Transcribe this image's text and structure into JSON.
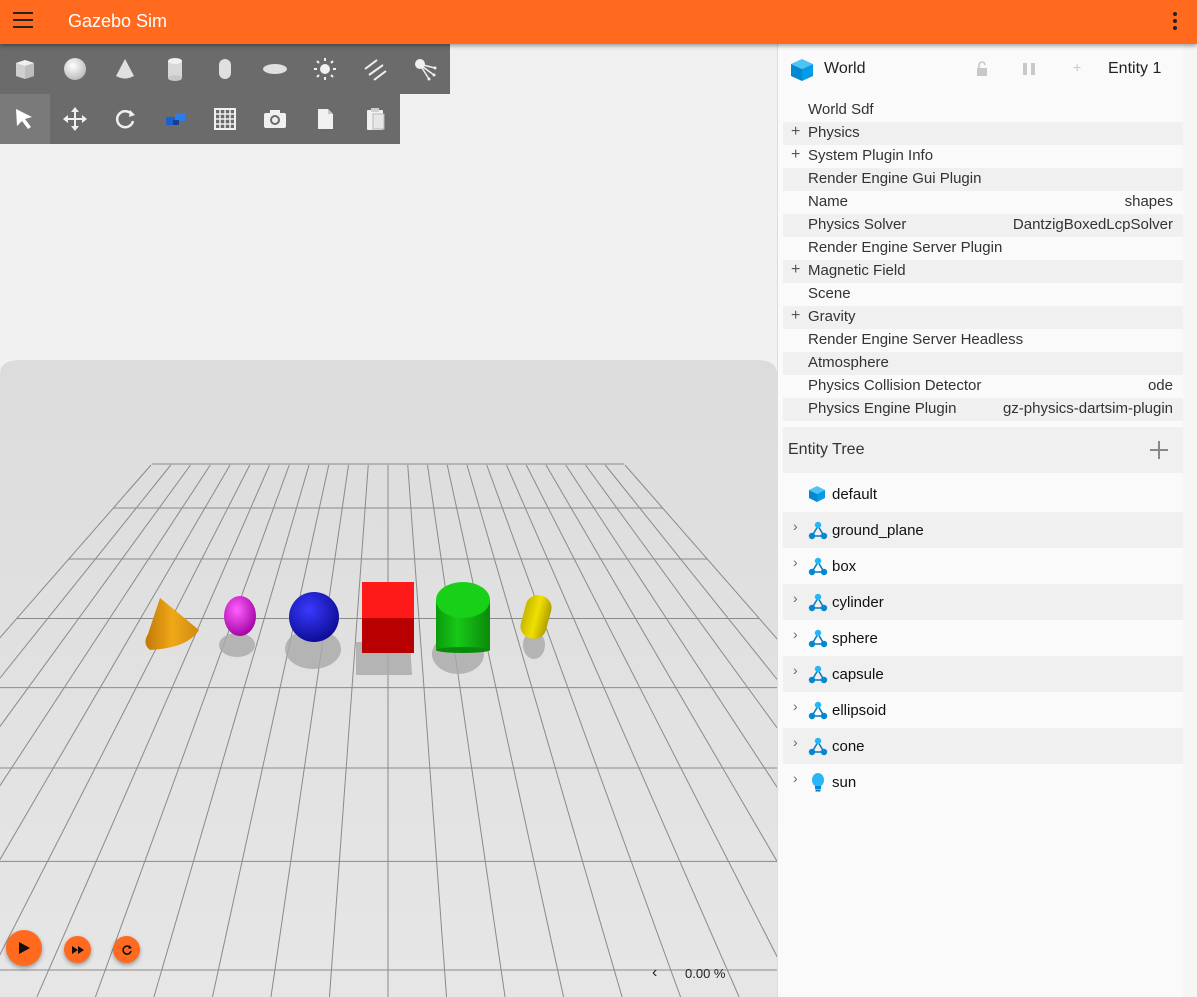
{
  "app": {
    "title": "Gazebo Sim"
  },
  "toolbar": {
    "shapes": [
      {
        "name": "box",
        "icon": "box-icon"
      },
      {
        "name": "sphere",
        "icon": "sphere-icon"
      },
      {
        "name": "cone",
        "icon": "cone-icon"
      },
      {
        "name": "cylinder",
        "icon": "cylinder-icon"
      },
      {
        "name": "capsule",
        "icon": "capsule-icon"
      },
      {
        "name": "ellipsoid",
        "icon": "ellipsoid-icon"
      },
      {
        "name": "point-light",
        "icon": "sun-icon"
      },
      {
        "name": "directional-light",
        "icon": "directional-light-icon"
      },
      {
        "name": "spot-light",
        "icon": "spot-light-icon"
      }
    ],
    "tools": [
      {
        "name": "select",
        "icon": "select-arrow-icon"
      },
      {
        "name": "translate",
        "icon": "translate-icon"
      },
      {
        "name": "rotate",
        "icon": "rotate-icon"
      },
      {
        "name": "transform-control",
        "icon": "transform-control-icon"
      },
      {
        "name": "grid",
        "icon": "grid-icon"
      },
      {
        "name": "screenshot",
        "icon": "camera-icon"
      },
      {
        "name": "copy",
        "icon": "copy-icon"
      },
      {
        "name": "paste",
        "icon": "paste-icon"
      }
    ]
  },
  "playback": {
    "rtf": "0.00 %",
    "rtf_chevron": "‹"
  },
  "component_inspector": {
    "title": "World",
    "entity": "Entity 1",
    "add_symbol": "+",
    "rows": [
      {
        "label": "World Sdf",
        "value": "",
        "expandable": false
      },
      {
        "label": "Physics",
        "value": "",
        "expandable": true
      },
      {
        "label": "System Plugin Info",
        "value": "",
        "expandable": true
      },
      {
        "label": "Render Engine Gui Plugin",
        "value": "",
        "expandable": false
      },
      {
        "label": "Name",
        "value": "shapes",
        "expandable": false
      },
      {
        "label": "Physics Solver",
        "value": "DantzigBoxedLcpSolver",
        "expandable": false
      },
      {
        "label": "Render Engine Server Plugin",
        "value": "",
        "expandable": false
      },
      {
        "label": "Magnetic Field",
        "value": "",
        "expandable": true
      },
      {
        "label": "Scene",
        "value": "",
        "expandable": false
      },
      {
        "label": "Gravity",
        "value": "",
        "expandable": true
      },
      {
        "label": "Render Engine Server Headless",
        "value": "",
        "expandable": false
      },
      {
        "label": "Atmosphere",
        "value": "",
        "expandable": false
      },
      {
        "label": "Physics Collision Detector",
        "value": "ode",
        "expandable": false
      },
      {
        "label": "Physics Engine Plugin",
        "value": "gz-physics-dartsim-plugin",
        "expandable": false
      }
    ]
  },
  "entity_tree": {
    "title": "Entity Tree",
    "items": [
      {
        "label": "default",
        "icon": "world-icon",
        "expandable": false
      },
      {
        "label": "ground_plane",
        "icon": "model-icon",
        "expandable": true
      },
      {
        "label": "box",
        "icon": "model-icon",
        "expandable": true
      },
      {
        "label": "cylinder",
        "icon": "model-icon",
        "expandable": true
      },
      {
        "label": "sphere",
        "icon": "model-icon",
        "expandable": true
      },
      {
        "label": "capsule",
        "icon": "model-icon",
        "expandable": true
      },
      {
        "label": "ellipsoid",
        "icon": "model-icon",
        "expandable": true
      },
      {
        "label": "cone",
        "icon": "model-icon",
        "expandable": true
      },
      {
        "label": "sun",
        "icon": "light-icon",
        "expandable": true
      }
    ]
  },
  "colors": {
    "accent": "#ff6a1f",
    "toolbar": "#6b6b6b",
    "cone": "#e89a10",
    "ellipsoid": "#e020e0",
    "sphere": "#1414d0",
    "box": "#e00000",
    "cylinder": "#10b810",
    "capsule": "#e0d000"
  }
}
